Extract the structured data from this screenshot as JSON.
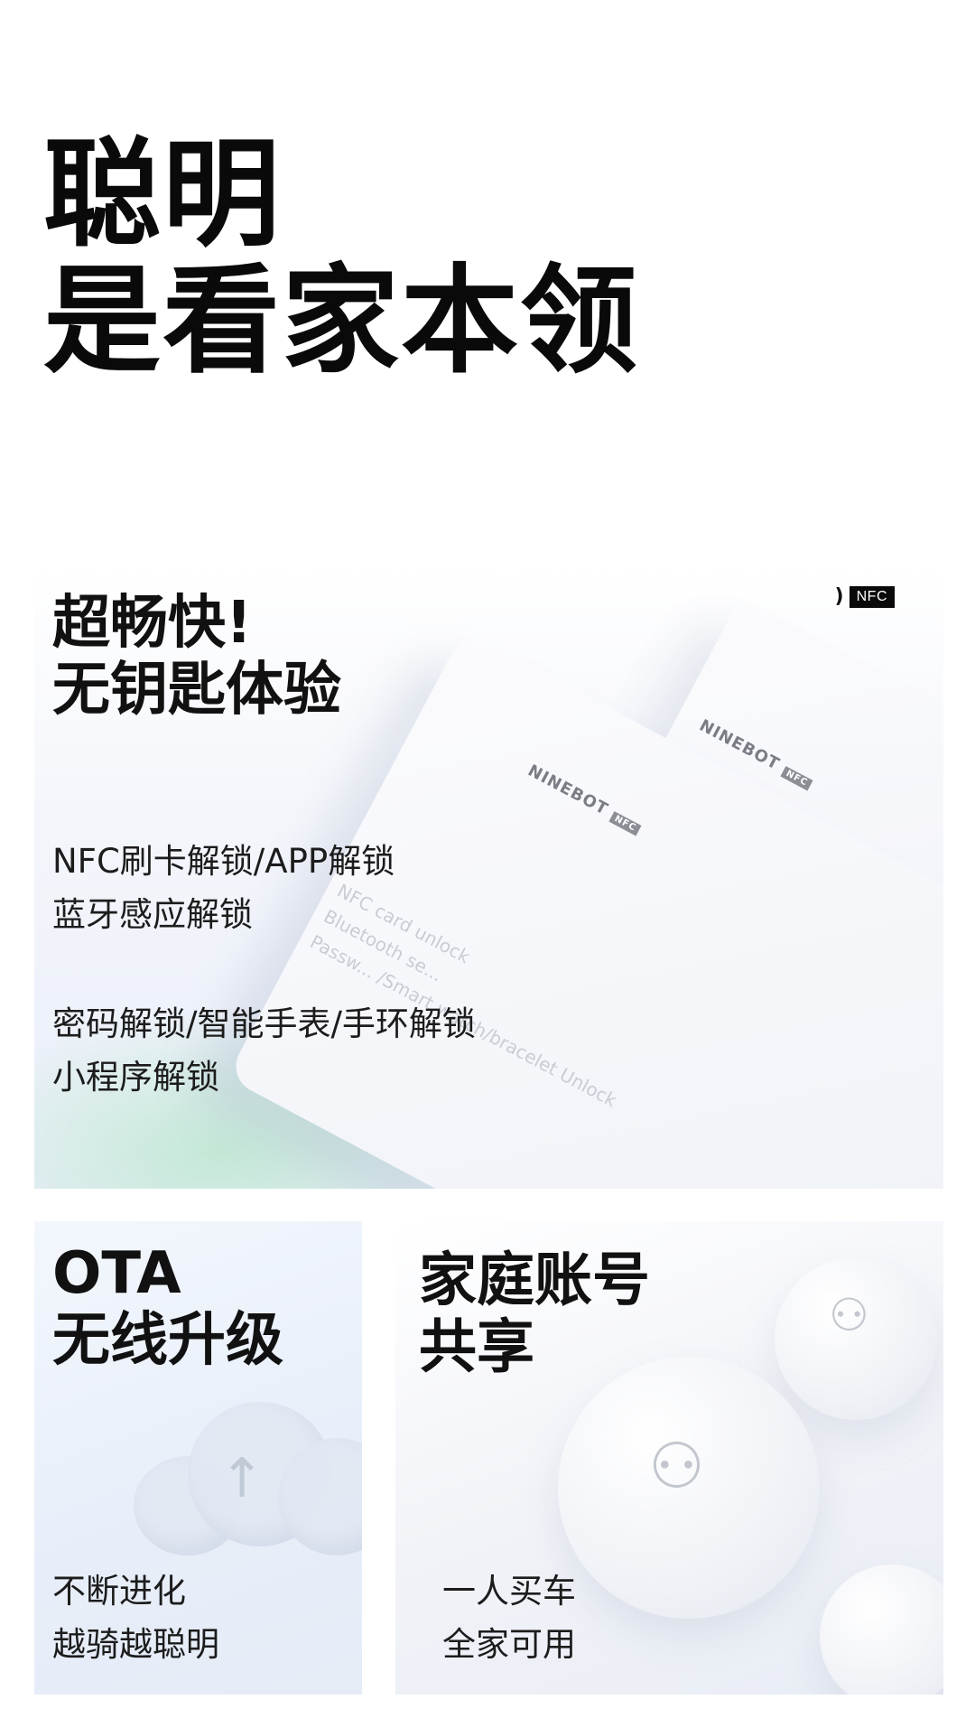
{
  "hero": {
    "line1": "聪明",
    "line2": "是看家本领"
  },
  "keyless_card": {
    "title_line1": "超畅快!",
    "title_line2": "无钥匙体验",
    "nfc_badge_label": "NFC",
    "card_brand": "NINEBOT",
    "card_nfc_label": "NFC",
    "desc_group1_line1": "NFC刷卡解锁/APP解锁",
    "desc_group1_line2": "蓝牙感应解锁",
    "desc_group2_line1": "密码解锁/智能手表/手环解锁",
    "desc_group2_line2": "小程序解锁",
    "ghost_lines": [
      "NFC card unlock",
      "Bluetooth se...",
      "Passw...  /Smart watch/bracelet Unlock"
    ]
  },
  "ota_card": {
    "title_line1": "OTA",
    "title_line2": "无线升级",
    "desc_line1": "不断进化",
    "desc_line2": "越骑越聪明"
  },
  "family_card": {
    "title_line1": "家庭账号",
    "title_line2": "共享",
    "desc_line1": "一人买车",
    "desc_line2": "全家可用"
  },
  "icons": [
    "nfc-wave-icon",
    "cloud-upload-icon",
    "person-icon"
  ]
}
